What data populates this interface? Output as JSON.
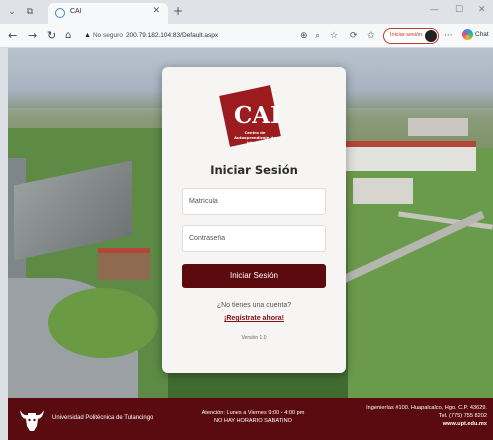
{
  "browser": {
    "tab_title": "CAI",
    "url_security": "No seguro",
    "url": "200.79.182.104:83/Default.aspx",
    "signin_label": "Iniciar sesión",
    "chat_label": "Chat"
  },
  "login": {
    "logo_word": "CAI",
    "logo_subtitle": "Centro de Autoaprendizaje de Idiomas",
    "title": "Iniciar Sesión",
    "matricula_placeholder": "Matrícula",
    "password_placeholder": "Contraseña",
    "submit_label": "Iniciar Sesión",
    "no_account_text": "¿No tienes una cuenta?",
    "register_link": "¡Regístrate ahora!",
    "version": "Versión 1.0"
  },
  "footer": {
    "university": "Universidad Politécnica de Tulancingo",
    "hours_line1": "Atención: Lunes a Viernes 9:00 - 4:00 pm",
    "hours_line2": "NO HAY HORARIO SABATINO",
    "address_line1": "Ingenierías #100. Huapalcalco, Hgo. C.P. 43629.",
    "address_line2": "Tel. (775) 755 8202",
    "website": "www.upt.edu.mx"
  },
  "colors": {
    "brand_maroon": "#5c0a0e",
    "logo_red": "#9b1b1f",
    "link_red": "#8a0f15"
  },
  "icons": [
    "tab-actions-icon",
    "workspaces-icon",
    "back-icon",
    "forward-icon",
    "refresh-icon",
    "home-icon",
    "warning-icon",
    "read-aloud-icon",
    "favorite-icon",
    "extensions-icon",
    "collections-icon",
    "more-icon",
    "copilot-icon",
    "bull-logo-icon"
  ]
}
